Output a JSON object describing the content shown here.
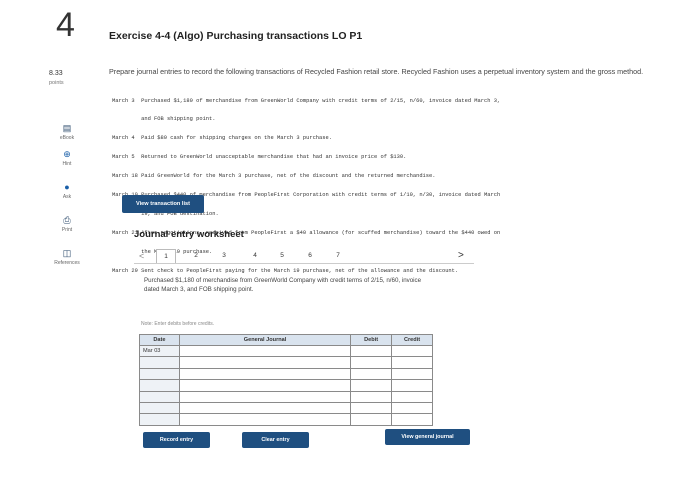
{
  "question": {
    "number": "4",
    "title": "Exercise 4-4 (Algo) Purchasing transactions LO P1",
    "points_value": "8.33",
    "points_label": "points"
  },
  "toolbar": {
    "items": [
      {
        "label": "eBook",
        "icon": "book-icon"
      },
      {
        "label": "Hint",
        "icon": "hint-icon"
      },
      {
        "label": "Ask",
        "icon": "ask-icon"
      },
      {
        "label": "Print",
        "icon": "print-icon"
      },
      {
        "label": "References",
        "icon": "references-icon"
      }
    ]
  },
  "instructions": "Prepare journal entries to record the following transactions of Recycled Fashion retail store. Recycled Fashion uses a perpetual inventory system and the gross method.",
  "transactions": [
    "March 3  Purchased $1,180 of merchandise from GreenWorld Company with credit terms of 2/15, n/60, invoice dated March 3,",
    "         and FOB shipping point.",
    "March 4  Paid $80 cash for shipping charges on the March 3 purchase.",
    "March 5  Returned to GreenWorld unacceptable merchandise that had an invoice price of $130.",
    "March 18 Paid GreenWorld for the March 3 purchase, net of the discount and the returned merchandise.",
    "March 19 Purchased $440 of merchandise from PeopleFirst Corporation with credit terms of 1/10, n/30, invoice dated March",
    "         19, and FOB destination.",
    "March 21 After negotiations, received from PeopleFirst a $40 allowance (for scuffed merchandise) toward the $440 owed on",
    "         the March 19 purchase.",
    "March 29 Sent check to PeopleFirst paying for the March 19 purchase, net of the allowance and the discount."
  ],
  "buttons": {
    "view_transaction_list": "View transaction list",
    "record_entry": "Record entry",
    "clear_entry": "Clear entry",
    "view_general_journal": "View general journal"
  },
  "worksheet": {
    "title": "Journal entry worksheet",
    "prev": "<",
    "next": ">",
    "pages": [
      "1",
      "2",
      "3",
      "4",
      "5",
      "6",
      "7"
    ],
    "active_page": "1",
    "task": "Purchased $1,180 of merchandise from GreenWorld Company with credit terms of 2/15, n/60, invoice dated March 3, and FOB shipping point.",
    "note": "Note: Enter debits before credits."
  },
  "journal": {
    "headers": {
      "date": "Date",
      "account": "General Journal",
      "debit": "Debit",
      "credit": "Credit"
    },
    "rows": [
      {
        "date": "Mar 03",
        "account": "",
        "debit": "",
        "credit": ""
      },
      {
        "date": "",
        "account": "",
        "debit": "",
        "credit": ""
      },
      {
        "date": "",
        "account": "",
        "debit": "",
        "credit": ""
      },
      {
        "date": "",
        "account": "",
        "debit": "",
        "credit": ""
      },
      {
        "date": "",
        "account": "",
        "debit": "",
        "credit": ""
      },
      {
        "date": "",
        "account": "",
        "debit": "",
        "credit": ""
      },
      {
        "date": "",
        "account": "",
        "debit": "",
        "credit": ""
      }
    ]
  }
}
